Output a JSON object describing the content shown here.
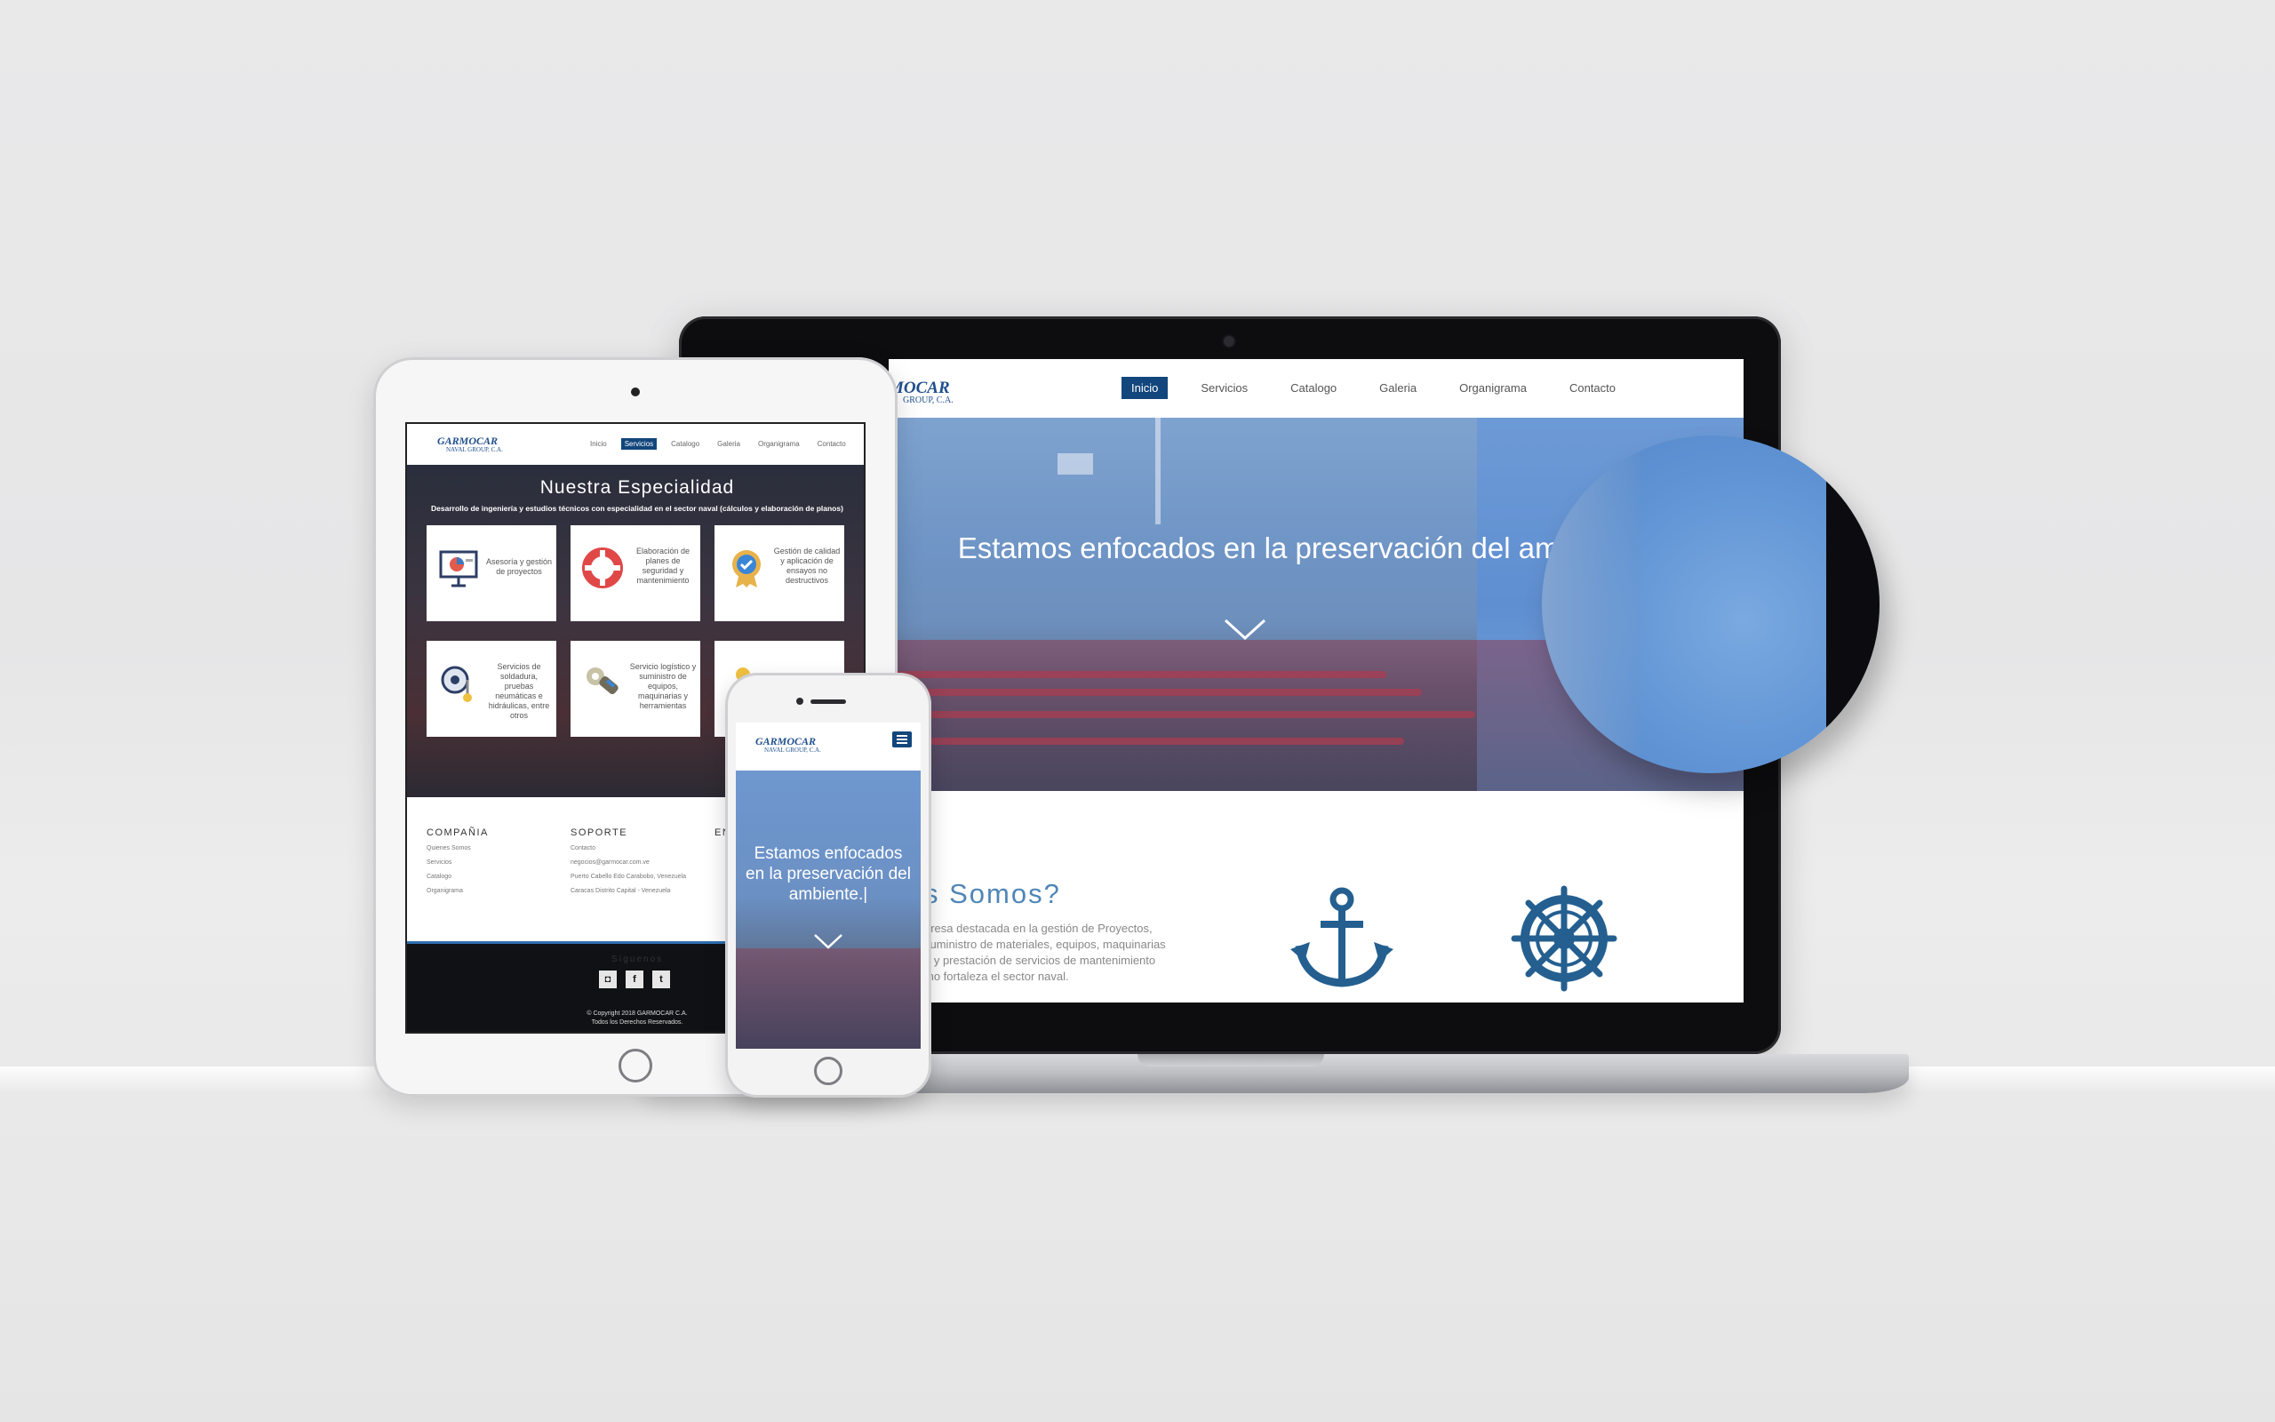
{
  "brand": {
    "logo": "GARMOCAR",
    "logo_sub": "NAVAL GROUP, C.A."
  },
  "laptop": {
    "nav": [
      "Inicio",
      "Servicios",
      "Catalogo",
      "Galeria",
      "Organigrama",
      "Contacto"
    ],
    "active": "Inicio",
    "logo_partial": "MOCAR",
    "logo_sub_partial": "GROUP, C.A.",
    "hero_title": "Estamos enfocados en la preservación del ambiente.|",
    "about_title_partial": "s Somos?",
    "about_text": [
      "presa destacada en la gestión de Proyectos,",
      "suministro de materiales, equipos, maquinarias",
      "a y prestación de servicios de mantenimiento",
      "mo fortaleza el sector naval."
    ]
  },
  "tablet": {
    "nav": [
      "Inicio",
      "Servicios",
      "Catalogo",
      "Galeria",
      "Organigrama",
      "Contacto"
    ],
    "active": "Servicios",
    "section_title": "Nuestra Especialidad",
    "section_subtitle": "Desarrollo de ingeniería y estudios técnicos con especialidad en el sector naval (cálculos y elaboración de planos)",
    "cards": [
      {
        "text": "Asesoría y gestión de proyectos",
        "icon": "presentation-chart-icon"
      },
      {
        "text": "Elaboración de planes de seguridad y mantenimiento",
        "icon": "lifebuoy-icon"
      },
      {
        "text": "Gestión de calidad y aplicación de ensayos no destructivos",
        "icon": "quality-badge-icon"
      },
      {
        "text": "Servicios de soldadura, pruebas neumáticas e hidráulicas, entre otros",
        "icon": "gauge-icon"
      },
      {
        "text": "Servicio logístico y suministro de equipos, maquinarias y herramientas",
        "icon": "wrench-icon"
      }
    ],
    "footer": {
      "col1_title": "COMPAÑIA",
      "col1_items": [
        "Quienes Somos",
        "Servicios",
        "Catalogo",
        "Organigrama"
      ],
      "col2_title": "SOPORTE",
      "col2_items": [
        "Contacto",
        "negocios@garmocar.com.ve",
        "Puerto Cabello Edo Carabobo, Venezuela",
        "Caracas Distrito Capital - Venezuela"
      ],
      "col3_title_partial": "EN IN",
      "follow": "Síguenos",
      "copyright": "© Copyright 2018 GARMOCAR C.A.",
      "rights": "Todos los Derechos Reservados."
    }
  },
  "phone": {
    "hero_title": "Estamos enfocados en la preservación del ambiente.|"
  },
  "colors": {
    "brand_blue": "#12467c",
    "icon_blue": "#245f90",
    "hero_blue": "#6f95c6"
  }
}
